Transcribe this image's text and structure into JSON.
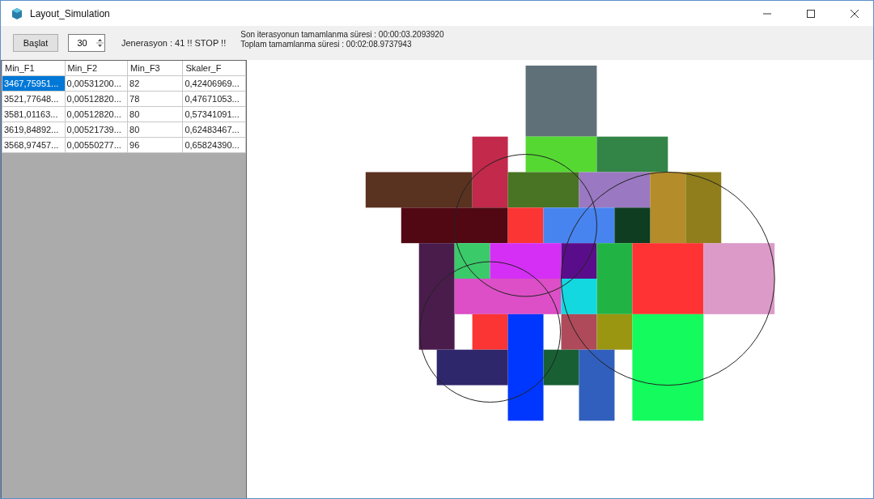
{
  "window": {
    "title": "Layout_Simulation"
  },
  "toolbar": {
    "start_button": "Başlat",
    "generations_spinner": {
      "value": "30"
    },
    "status": "Jenerasyon : 41 !! STOP !!",
    "timings": [
      "Son iterasyonun tamamlanma süresi : 00:00:03.2093920",
      "Toplam tamamlanma süresi : 00:02:08.9737943"
    ]
  },
  "table": {
    "columns": [
      "Min_F1",
      "Min_F2",
      "Min_F3",
      "Skaler_F"
    ],
    "rows": [
      {
        "cells": [
          "3467,75951...",
          "0,00531200...",
          "82",
          "0,42406969..."
        ],
        "selected": true
      },
      {
        "cells": [
          "3521,77648...",
          "0,00512820...",
          "78",
          "0,47671053..."
        ],
        "selected": false
      },
      {
        "cells": [
          "3581,01163...",
          "0,00512820...",
          "80",
          "0,57341091..."
        ],
        "selected": false
      },
      {
        "cells": [
          "3619,84892...",
          "0,00521739...",
          "80",
          "0,62483467..."
        ],
        "selected": false
      },
      {
        "cells": [
          "3568,97457...",
          "0,00550277...",
          "96",
          "0,65824390..."
        ],
        "selected": false
      }
    ]
  }
}
